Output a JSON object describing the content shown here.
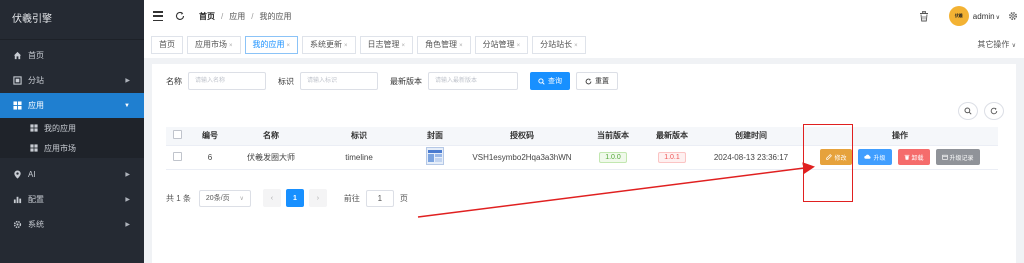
{
  "brand": "伏羲引擎",
  "sidebar": {
    "items": [
      {
        "label": "首页",
        "icon": "home-icon"
      },
      {
        "label": "分站",
        "icon": "site-icon"
      },
      {
        "label": "应用",
        "icon": "apps-grid-icon"
      },
      {
        "label": "我的应用",
        "icon": "grid-icon"
      },
      {
        "label": "应用市场",
        "icon": "grid-icon"
      },
      {
        "label": "AI",
        "icon": "location-pin-icon"
      },
      {
        "label": "配置",
        "icon": "bar-chart-icon"
      },
      {
        "label": "系统",
        "icon": "gear-icon"
      }
    ]
  },
  "header": {
    "breadcrumb": [
      "首页",
      "应用",
      "我的应用"
    ],
    "username": "admin",
    "avatar_text": "伏羲"
  },
  "tabs": [
    "首页",
    "应用市场",
    "我的应用",
    "系统更新",
    "日志管理",
    "角色管理",
    "分站管理",
    "分站站长"
  ],
  "other_ops": "其它操作",
  "search": {
    "name_label": "名称",
    "name_placeholder": "请输入名称",
    "id_label": "标识",
    "id_placeholder": "请输入标识",
    "version_label": "最新版本",
    "version_placeholder": "请输入最新版本",
    "query_label": "查询",
    "reset_label": "重置"
  },
  "table": {
    "headers": [
      "编号",
      "名称",
      "标识",
      "封面",
      "授权码",
      "当前版本",
      "最新版本",
      "创建时间",
      "",
      "操作"
    ],
    "row": {
      "id": "6",
      "name": "伏羲发圈大师",
      "identifier": "timeline",
      "auth_code": "VSH1esymbo2Hqa3a3hWN",
      "current_version": "1.0.0",
      "latest_version": "1.0.1",
      "created": "2024-08-13 23:36:17"
    },
    "actions": [
      "修改",
      "升级",
      "卸载",
      "升级记录"
    ]
  },
  "pager": {
    "total": "共 1 条",
    "page_size": "20条/页",
    "current_page": "1",
    "goto_label": "前往",
    "goto_value": "1",
    "page_suffix": "页"
  },
  "colors": {
    "sidebar_bg": "#252a33",
    "accent": "#1890ff",
    "edit": "#e6a23c",
    "upgrade": "#409eff",
    "uninstall": "#f56c6c",
    "log": "#909399",
    "annotation": "#e02020"
  }
}
